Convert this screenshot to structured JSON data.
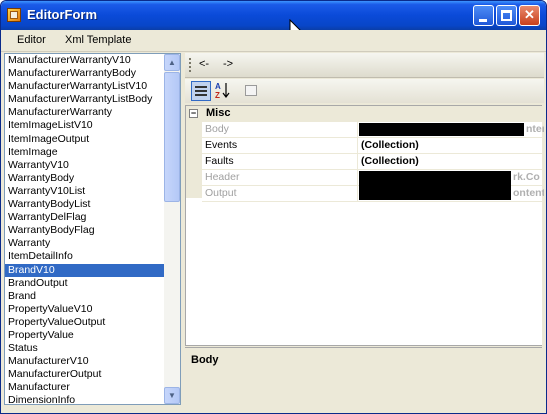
{
  "window": {
    "title": "EditorForm",
    "controls": {
      "minimize": "",
      "maximize": "",
      "close": "✕"
    }
  },
  "menubar": {
    "items": [
      {
        "label": "Editor"
      },
      {
        "label": "Xml Template"
      }
    ]
  },
  "list": {
    "items": [
      "ManufacturerWarrantyV10",
      "ManufacturerWarrantyBody",
      "ManufacturerWarrantyListV10",
      "ManufacturerWarrantyListBody",
      "ManufacturerWarranty",
      "ItemImageListV10",
      "ItemImageOutput",
      "ItemImage",
      "WarrantyV10",
      "WarrantyBody",
      "WarrantyV10List",
      "WarrantyBodyList",
      "WarrantyDelFlag",
      "WarrantyBodyFlag",
      "Warranty",
      "ItemDetailInfo",
      "BrandV10",
      "BrandOutput",
      "Brand",
      "PropertyValueV10",
      "PropertyValueOutput",
      "PropertyValue",
      "Status",
      "ManufacturerV10",
      "ManufacturerOutput",
      "Manufacturer",
      "DimensionInfo"
    ],
    "selected": "BrandV10",
    "scroll_up": "▲",
    "scroll_down": "▼"
  },
  "nav": {
    "back": "<-",
    "forward": "->"
  },
  "toolbar": {
    "az": "A\nZ"
  },
  "grid": {
    "category": "Misc",
    "expander": "−",
    "properties": [
      {
        "name": "Body",
        "value": "",
        "readonly": true,
        "redacted": true,
        "trail": "nten"
      },
      {
        "name": "Events",
        "value": "(Collection)",
        "readonly": false,
        "redacted": false
      },
      {
        "name": "Faults",
        "value": "(Collection)",
        "readonly": false,
        "redacted": false
      },
      {
        "name": "Header",
        "value": "",
        "readonly": true,
        "redacted": true,
        "trail": "rk.Co"
      },
      {
        "name": "Output",
        "value": "",
        "readonly": true,
        "redacted": true,
        "trail": "ontent"
      }
    ]
  },
  "description": {
    "title": "Body"
  }
}
